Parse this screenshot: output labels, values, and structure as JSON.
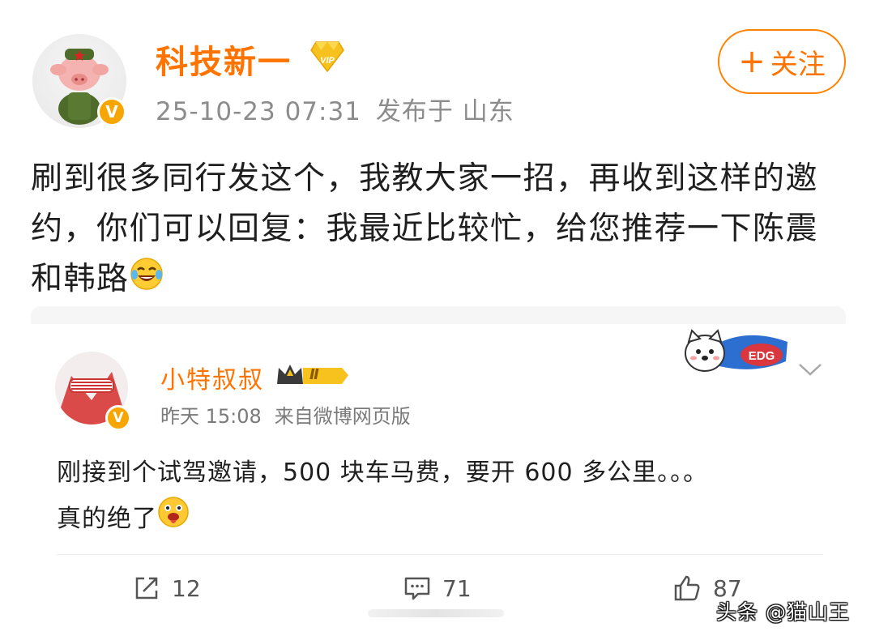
{
  "post": {
    "author_name": "科技新一",
    "timestamp": "25-10-23 07:31",
    "location": "发布于 山东",
    "follow_label": "关注",
    "follow_plus": "+",
    "text": "刷到很多同行发这个，我教大家一招，再收到这样的邀约，你们可以回复：我最近比较忙，给您推荐一下陈震和韩路",
    "emoji_icon": "laughing-tears-icon",
    "vip_icon": "vip-diamond-icon",
    "verified_badge": "V"
  },
  "quoted": {
    "author_name": "小特叔叔",
    "level": "Ⅱ",
    "timestamp": "昨天 15:08",
    "source": "来自微博网页版",
    "text_line1": "刚接到个试驾邀请，500 块车马费，要开 600 多公里。。。",
    "text_line2": "真的绝了",
    "emoji_icon": "drooling-face-icon",
    "sticker_icon": "dog-edg-sticker-icon",
    "verified_badge": "V"
  },
  "actions": {
    "repost_count": "12",
    "comment_count": "71",
    "like_count": "87"
  },
  "watermark": "头条 @猫山王",
  "colors": {
    "accent_orange": "#ff7300",
    "meta_gray": "#8c8c8c",
    "badge_yellow": "#f7a500"
  }
}
